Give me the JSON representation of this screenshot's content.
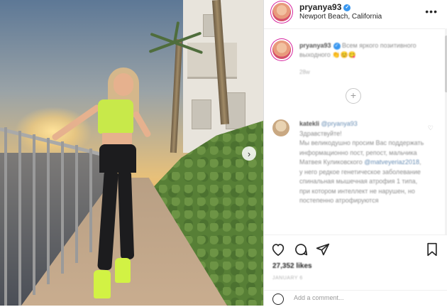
{
  "post": {
    "username": "pryanya93",
    "location": "Newport Beach, California",
    "more_icon": "more-options-icon"
  },
  "caption": {
    "username": "pryanya93",
    "text": "Всем яркого позитивного выходного",
    "time": "28w"
  },
  "load_more": "+",
  "comment": {
    "username": "katekli",
    "mention": "@pryanya93",
    "text_1": "Здравствуйте!",
    "text_2": "Мы великодушно просим Вас поддержать информационно пост, репост, мальчика Матвея Куликовского",
    "mention_2": "@matveyeriaz2018",
    "text_3": ", у него редкое генетическое заболевание спинальная мышечная атрофия 1 типа, при котором интеллект не нарушен, но постепенно атрофируются"
  },
  "actions": {
    "likes": "27,352 likes",
    "date": "JANUARY 6"
  },
  "add_comment": {
    "placeholder": "Add a comment..."
  },
  "colors": {
    "accent": "#3897f0",
    "story_ring": "#d6249f",
    "top_color": "#c8e94a"
  }
}
